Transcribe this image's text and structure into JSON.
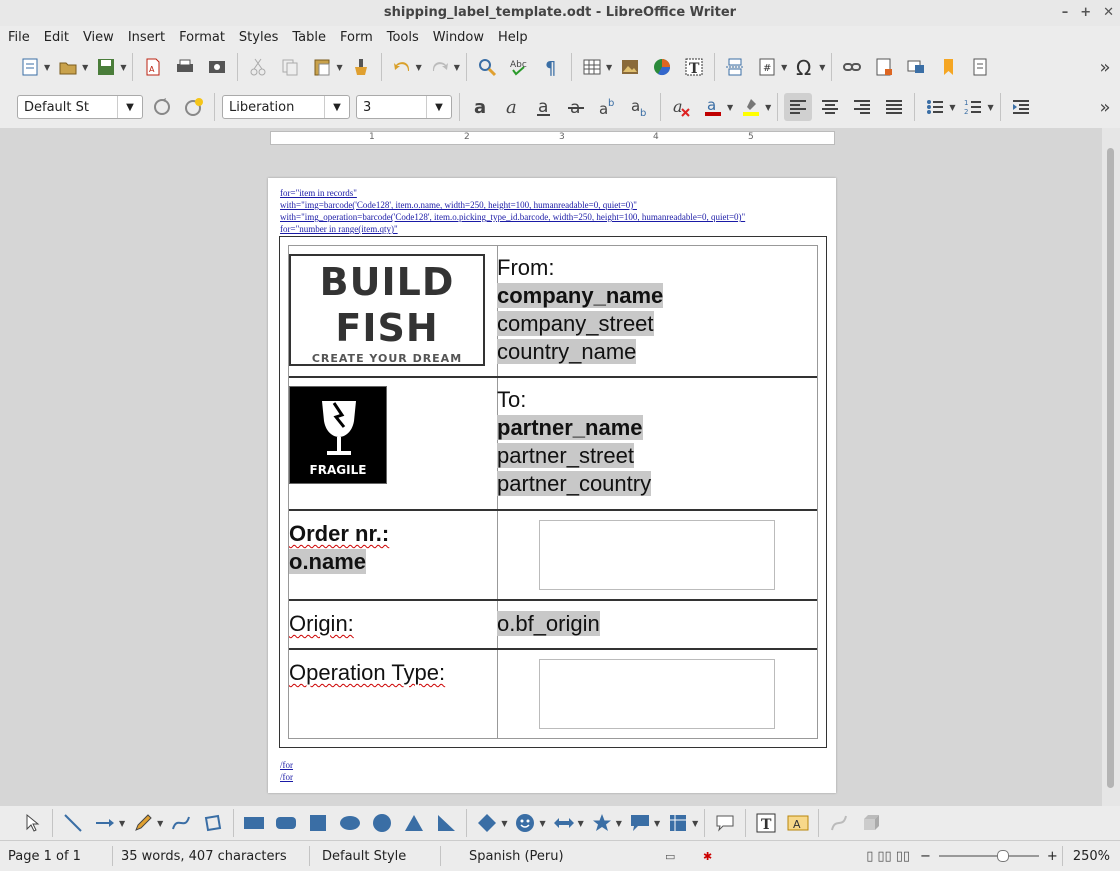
{
  "window": {
    "title": "shipping_label_template.odt - LibreOffice Writer"
  },
  "menu": [
    "File",
    "Edit",
    "View",
    "Insert",
    "Format",
    "Styles",
    "Table",
    "Form",
    "Tools",
    "Window",
    "Help"
  ],
  "format_bar": {
    "paragraph_style": "Default St",
    "font_name": "Liberation",
    "font_size": "3"
  },
  "ruler": {
    "numbers": [
      "1",
      "2",
      "3",
      "4",
      "5"
    ]
  },
  "document": {
    "fields_top": [
      "for=\"item in records\"",
      "with=\"img=barcode('Code128', item.o.name, width=250, height=100, humanreadable=0, quiet=0)\"",
      "with=\"img_operation=barcode('Code128', item.o.picking_type_id.barcode, width=250, height=100, humanreadable=0, quiet=0)\"",
      "for=\"number in range(item.qty)\""
    ],
    "fields_bottom": [
      "/for",
      "/for"
    ],
    "logo": {
      "line1": "BUILD",
      "line2": "FISH",
      "tagline": "CREATE YOUR DREAM"
    },
    "fragile_label": "FRAGILE",
    "from_label": "From:",
    "company_name": "company_name",
    "company_street": "company_street",
    "country_name": "country_name",
    "to_label": "To:",
    "partner_name": "partner_name",
    "partner_street": "partner_street",
    "partner_country": "partner_country",
    "order_label": "Order nr.:",
    "order_value": "o.name",
    "origin_label": "Origin:",
    "origin_value": "o.bf_origin",
    "operation_label": "Operation Type:"
  },
  "status": {
    "page": "Page 1 of 1",
    "words": "35 words, 407 characters",
    "style": "Default Style",
    "language": "Spanish (Peru)",
    "zoom": "250%"
  },
  "colors": {
    "accent_font_color": "#c00000",
    "highlight_color": "#ffff00",
    "field_color": "#1a1aa6"
  }
}
